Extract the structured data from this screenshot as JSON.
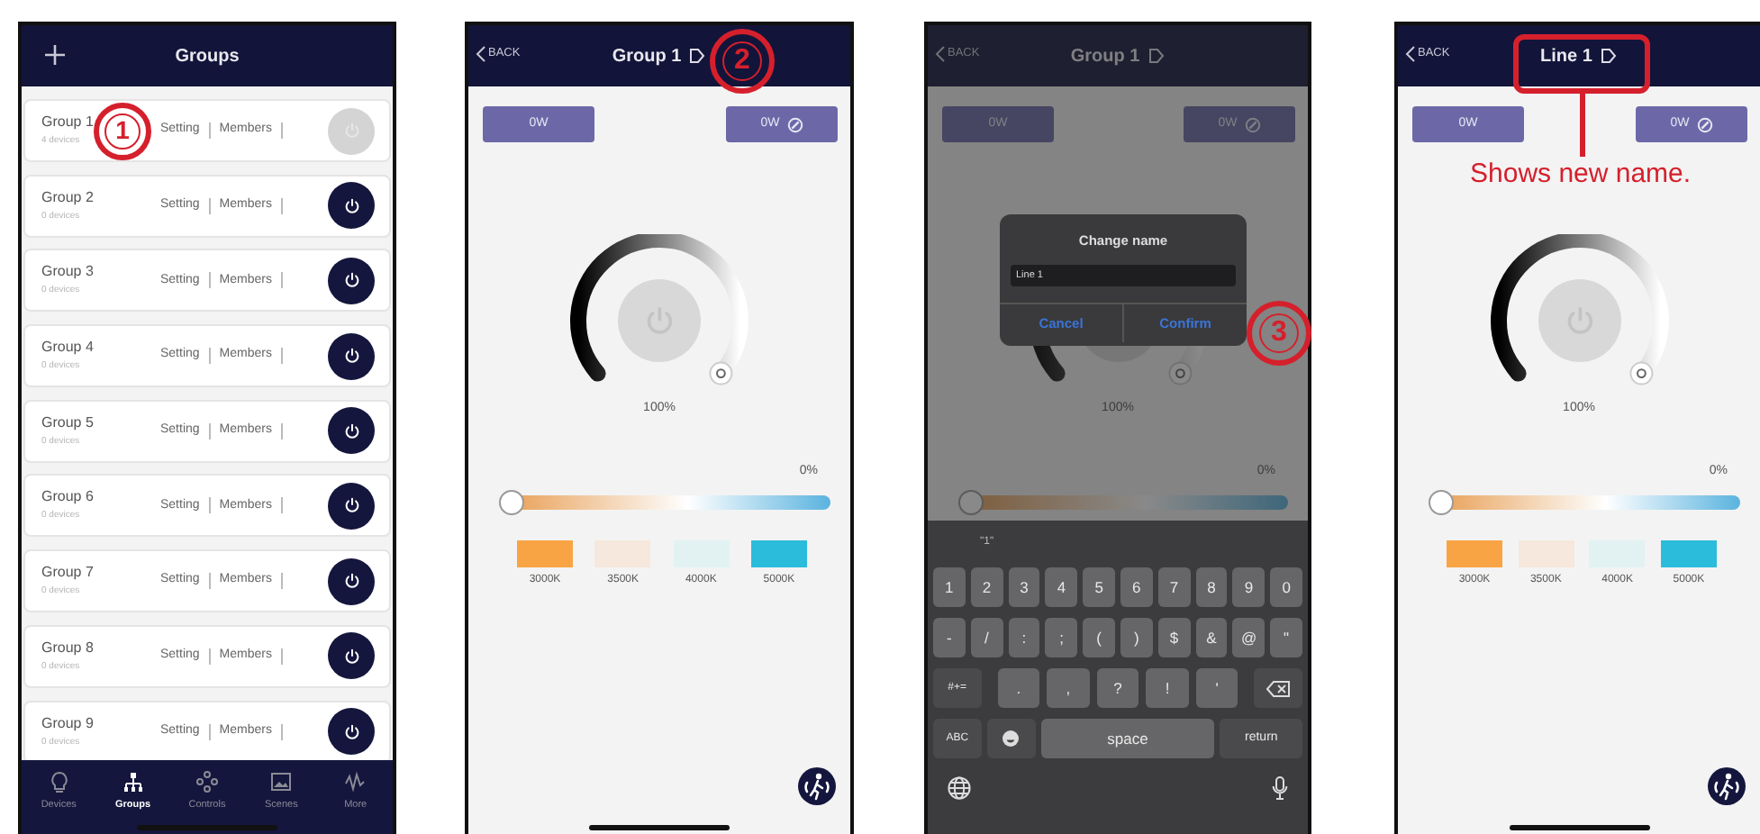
{
  "screens": [
    {
      "kind": "group_list",
      "title": "Groups",
      "groups": [
        {
          "name": "Group 1",
          "count": "4 devices",
          "setting": "Setting",
          "members": "Members",
          "on": false
        },
        {
          "name": "Group 2",
          "count": "0 devices",
          "setting": "Setting",
          "members": "Members",
          "on": true
        },
        {
          "name": "Group 3",
          "count": "0 devices",
          "setting": "Setting",
          "members": "Members",
          "on": true
        },
        {
          "name": "Group 4",
          "count": "0 devices",
          "setting": "Setting",
          "members": "Members",
          "on": true
        },
        {
          "name": "Group 5",
          "count": "0 devices",
          "setting": "Setting",
          "members": "Members",
          "on": true
        },
        {
          "name": "Group 6",
          "count": "0 devices",
          "setting": "Setting",
          "members": "Members",
          "on": true
        },
        {
          "name": "Group 7",
          "count": "0 devices",
          "setting": "Setting",
          "members": "Members",
          "on": true
        },
        {
          "name": "Group 8",
          "count": "0 devices",
          "setting": "Setting",
          "members": "Members",
          "on": true
        },
        {
          "name": "Group 9",
          "count": "0 devices",
          "setting": "Setting",
          "members": "Members",
          "on": true
        }
      ],
      "tabs": [
        {
          "label": "Devices",
          "selected": false
        },
        {
          "label": "Groups",
          "selected": true
        },
        {
          "label": "Controls",
          "selected": false
        },
        {
          "label": "Scenes",
          "selected": false
        },
        {
          "label": "More",
          "selected": false
        }
      ],
      "annotation": {
        "kind": "step",
        "number": "1"
      }
    },
    {
      "kind": "light_control",
      "back": "BACK",
      "title": "Group 1",
      "left_button": "0W",
      "right_button": "0W",
      "dial": {
        "level": 1,
        "reading": "100%"
      },
      "color_temperature": {
        "level": 0,
        "reading": "0%"
      },
      "swatches": [
        {
          "label": "3000K",
          "color": "#f9a444"
        },
        {
          "label": "3500K",
          "color": "#f6e8dc"
        },
        {
          "label": "4000K",
          "color": "#e2f2f2"
        },
        {
          "label": "5000K",
          "color": "#2bbcdb"
        }
      ],
      "annotation": {
        "kind": "step",
        "number": "2"
      }
    },
    {
      "kind": "light_control",
      "back": "BACK",
      "title": "Group 1",
      "left_button": "0W",
      "right_button": "0W",
      "dial": {
        "level": 1,
        "reading": "100%"
      },
      "color_temperature": {
        "level": 0,
        "reading": "0%"
      },
      "dialog": {
        "title": "Change name",
        "value": "Line 1",
        "cancel": "Cancel",
        "confirm": "Confirm"
      },
      "keyboard": {
        "suggestion": "\"1\"",
        "digits": [
          "1",
          "2",
          "3",
          "4",
          "5",
          "6",
          "7",
          "8",
          "9",
          "0"
        ],
        "symbols": [
          "-",
          "/",
          ":",
          ";",
          "(",
          ")",
          "$",
          "&",
          "@",
          "\""
        ],
        "mode_key": "#+=",
        "punctuation": [
          ".",
          ",",
          "?",
          "!",
          "'"
        ],
        "abc_key": "ABC",
        "space_key": "space",
        "return_key": "return"
      },
      "annotation": {
        "kind": "step",
        "number": "3"
      }
    },
    {
      "kind": "light_control",
      "back": "BACK",
      "title": "Line 1",
      "left_button": "0W",
      "right_button": "0W",
      "dial": {
        "level": 1,
        "reading": "100%"
      },
      "color_temperature": {
        "level": 0,
        "reading": "0%"
      },
      "swatches": [
        {
          "label": "3000K",
          "color": "#f9a444"
        },
        {
          "label": "3500K",
          "color": "#f6e8dc"
        },
        {
          "label": "4000K",
          "color": "#e2f2f2"
        },
        {
          "label": "5000K",
          "color": "#2bbcdb"
        }
      ],
      "annotation": {
        "kind": "callout",
        "text": "Shows new name."
      }
    }
  ]
}
